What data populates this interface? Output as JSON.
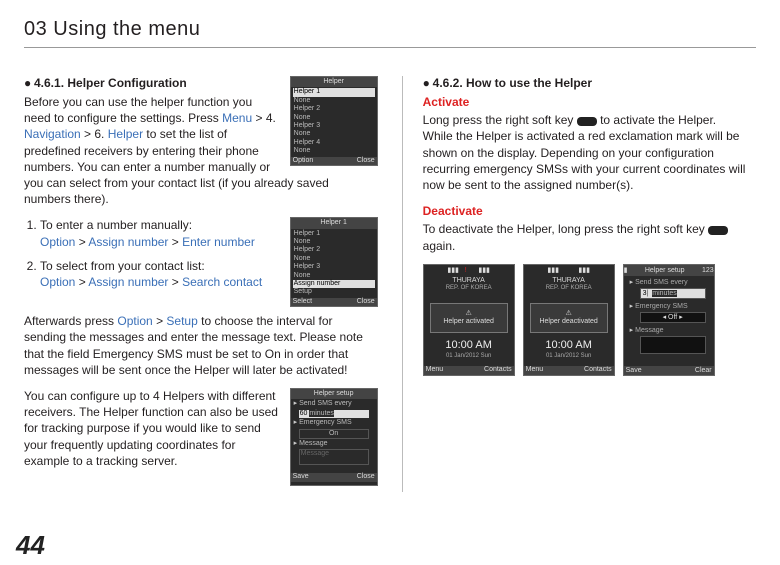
{
  "chapter": "03 Using the menu",
  "page_number": "44",
  "left": {
    "heading": "4.6.1. Helper Configuration",
    "intro_a": "Before you can use the helper function you need to configure the settings. Press ",
    "intro_menu": "Menu",
    "intro_b": " > 4. ",
    "intro_nav": "Navigation",
    "intro_c": " > 6. ",
    "intro_helper": "Helper",
    "intro_d": " to set the list of predefined receivers by entering their phone numbers. You can enter a number manually or you can select from your contact list (if you already saved numbers there).",
    "step1_text": "To enter a number manually:",
    "step1_path_a": "Option",
    "step1_path_b": "Assign number",
    "step1_path_c": "Enter number",
    "step2_text": "To select from your contact list:",
    "step2_path_a": "Option",
    "step2_path_b": "Assign number",
    "step2_path_c": "Search contact",
    "after_a": "Afterwards press ",
    "after_opt": "Option",
    "after_b": " > ",
    "after_setup": "Setup",
    "after_c": " to choose the interval for sending the messages and enter the message text. Please note that the field Emergency SMS must be set to On in order that messages will be sent once the Helper will later be activated!",
    "configure_text": "You can configure up to 4 Helpers with different receivers. The Helper function can also be used for tracking purpose if you would like to send your frequently updating coordinates for example to a tracking server.",
    "screen1": {
      "title": "Helper",
      "rows": [
        "Helper 1",
        "None",
        "Helper 2",
        "None",
        "Helper 3",
        "None",
        "Helper 4",
        "None"
      ],
      "left_soft": "Option",
      "right_soft": "Close"
    },
    "screen2": {
      "title": "Helper 1",
      "rows": [
        "Helper 1",
        "None",
        "Helper 2",
        "None",
        "Helper 3",
        "None"
      ],
      "sel": "Assign number",
      "setup_row": "Setup",
      "left_soft": "Select",
      "right_soft": "Close"
    },
    "screen3": {
      "title": "Helper setup",
      "f1_label": "Send SMS every",
      "f1_val": "60",
      "f1_unit": "minutes",
      "f2_label": "Emergency SMS",
      "f2_val": "On",
      "f3_label": "Message",
      "f3_val": "Message",
      "left_soft": "Save",
      "right_soft": "Close"
    }
  },
  "right": {
    "heading": "4.6.2. How to use the Helper",
    "activate_label": "Activate",
    "activate_a": "Long press the right soft key ",
    "activate_b": " to activate the Helper.",
    "activate_c": "While the Helper is activated a red exclamation mark will be shown on the display. Depending on your configuration recurring emergency SMSs with your current coordinates will now be sent to the assigned number(s).",
    "deactivate_label": "Deactivate",
    "deactivate_a": "To deactivate the Helper, long press the right soft key ",
    "deactivate_b": " again.",
    "big1": {
      "brand": "THURAYA",
      "region": "REP.  OF KOREA",
      "popup": "Helper activated",
      "time": "10:00 AM",
      "date": "01 Jan/2012 Sun",
      "left_soft": "Menu",
      "right_soft": "Contacts"
    },
    "big2": {
      "brand": "THURAYA",
      "region": "REP.  OF KOREA",
      "popup": "Helper deactivated",
      "time": "10:00 AM",
      "date": "01 Jan/2012 Sun",
      "left_soft": "Menu",
      "right_soft": "Contacts"
    },
    "setup": {
      "title": "Helper setup",
      "icon_right": "123",
      "f1_label": "Send SMS every",
      "f1_val": "3",
      "f1_unit": "minutes",
      "f2_label": "Emergency SMS",
      "f2_val": "Off",
      "f3_label": "Message",
      "f3_val": "",
      "left_soft": "Save",
      "right_soft": "Clear"
    }
  }
}
